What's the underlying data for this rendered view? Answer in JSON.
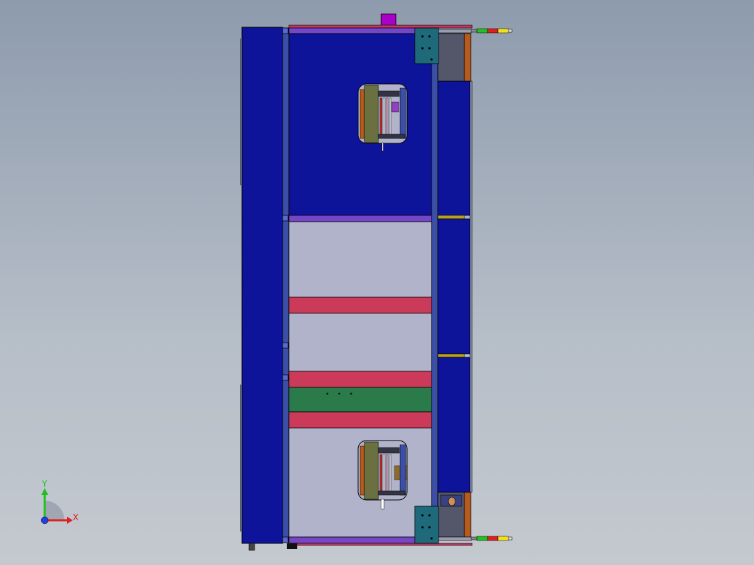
{
  "colors": {
    "background_top": "#8e9bad",
    "background_bottom": "#c4c9cf",
    "frame_blue": "#0e149a",
    "rail_blue": "#3c4fa8",
    "purple": "#7546c8",
    "magenta": "#aa00c8",
    "panel_gray": "#b0b3ca",
    "belt_red": "#cc3a5a",
    "belt_green": "#2a7a4a",
    "teal": "#1f6a7a",
    "olive": "#b8a020",
    "orange_brown": "#b85a1c",
    "beacon_green": "#22c020",
    "beacon_red": "#e02020",
    "beacon_yellow": "#f0e020"
  },
  "triad": {
    "x_label": "X",
    "y_label": "Y",
    "x_color": "#e02020",
    "y_color": "#20c020",
    "z_color": "#2040e0"
  }
}
